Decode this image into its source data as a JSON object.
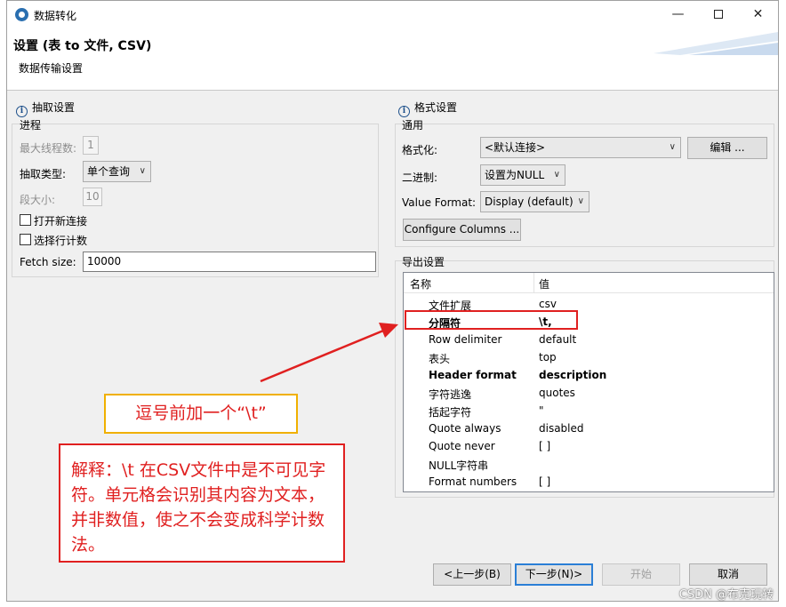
{
  "window": {
    "title": "数据转化"
  },
  "header": {
    "title": "设置 (表 to 文件, CSV)",
    "subtitle": "数据传输设置"
  },
  "extract": {
    "section_title": "抽取设置",
    "group_label": "进程",
    "max_threads_label": "最大线程数:",
    "max_threads_value": "1",
    "extract_type_label": "抽取类型:",
    "extract_type_value": "单个查询",
    "segment_size_label": "段大小:",
    "segment_size_value": "10",
    "open_new_connection_label": "打开新连接",
    "select_row_count_label": "选择行计数",
    "fetch_size_label": "Fetch size:",
    "fetch_size_value": "10000"
  },
  "format": {
    "section_title": "格式设置",
    "group_label": "通用",
    "formatter_label": "格式化:",
    "formatter_value": "<默认连接>",
    "edit_button": "编辑 ...",
    "binary_label": "二进制:",
    "binary_value": "设置为NULL",
    "value_format_label": "Value Format:",
    "value_format_value": "Display (default)",
    "configure_columns_button": "Configure Columns ..."
  },
  "export": {
    "group_label": "导出设置",
    "col_name": "名称",
    "col_value": "值",
    "rows": [
      {
        "name": "文件扩展",
        "value": "csv",
        "bold": false
      },
      {
        "name": "分隔符",
        "value": "\\t,",
        "bold": true
      },
      {
        "name": "Row delimiter",
        "value": "default",
        "bold": false
      },
      {
        "name": "表头",
        "value": "top",
        "bold": false
      },
      {
        "name": "Header format",
        "value": "description",
        "bold": true
      },
      {
        "name": "字符逃逸",
        "value": "quotes",
        "bold": false
      },
      {
        "name": "括起字符",
        "value": "\"",
        "bold": false
      },
      {
        "name": "Quote always",
        "value": "disabled",
        "bold": false
      },
      {
        "name": "Quote never",
        "value": "[ ]",
        "bold": false
      },
      {
        "name": "NULL字符串",
        "value": "",
        "bold": false
      },
      {
        "name": "Format numbers",
        "value": "[ ]",
        "bold": false
      }
    ]
  },
  "footer": {
    "back_button": "<上一步(B)",
    "next_button": "下一步(N)>",
    "start_button": "开始",
    "cancel_button": "取消"
  },
  "annotations": {
    "callout_text": "逗号前加一个“\\t”",
    "explanation_text": "解释：\\t 在CSV文件中是不可见字符。单元格会识别其内容为文本，并非数值，使之不会变成科学计数法。",
    "highlight_color": "#e02020",
    "callout_border_color": "#f0b000"
  },
  "watermark": "CSDN @布克玩转",
  "colors": {
    "primary_button_border": "#2b7fd6",
    "window_bg": "#f0f0f0"
  }
}
